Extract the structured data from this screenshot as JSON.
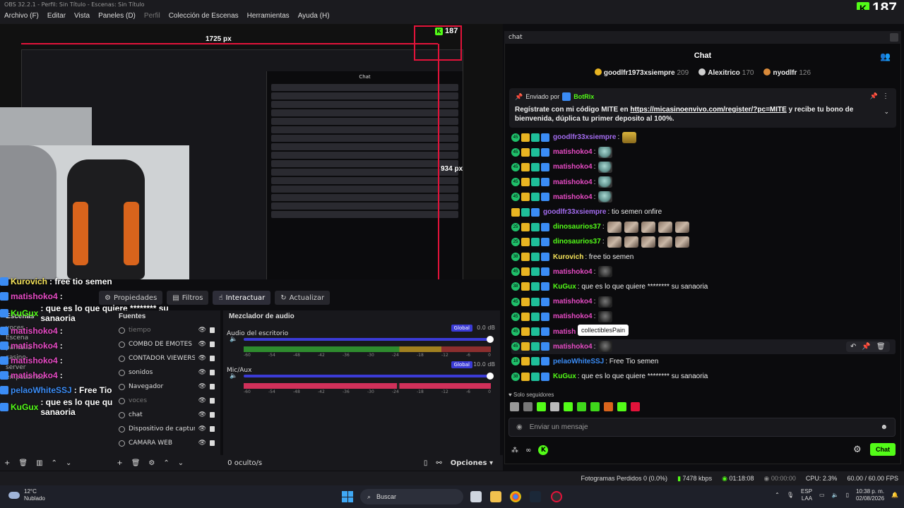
{
  "window": {
    "title": "OBS 32.2.1 - Perfil: Sin Título - Escenas: Sin Título",
    "viewer_count": "187"
  },
  "menu": [
    {
      "label": "Archivo (F)",
      "dim": false
    },
    {
      "label": "Editar",
      "dim": false
    },
    {
      "label": "Vista",
      "dim": false
    },
    {
      "label": "Paneles (D)",
      "dim": false
    },
    {
      "label": "Perfil",
      "dim": true
    },
    {
      "label": "Colección de Escenas",
      "dim": false
    },
    {
      "label": "Herramientas",
      "dim": false
    },
    {
      "label": "Ayuda (H)",
      "dim": false
    }
  ],
  "preview": {
    "width_label": "1725 px",
    "height_label": "934 px",
    "nested_count": "187",
    "nested_chat_title": "Chat"
  },
  "overlay_chat": [
    {
      "user": "Kurovich",
      "text": ": free tio semen",
      "color": "#f7e45a"
    },
    {
      "user": "matishoko4",
      "text": ":",
      "color": "#e64bc4"
    },
    {
      "user": "KuGux",
      "text": ": que es lo que quiere ******** su sanaoria",
      "color": "#53fc18"
    },
    {
      "user": "matishoko4",
      "text": ":",
      "color": "#e64bc4"
    },
    {
      "user": "matishoko4",
      "text": ":",
      "color": "#e64bc4"
    },
    {
      "user": "matishoko4",
      "text": ":",
      "color": "#e64bc4"
    },
    {
      "user": "matishoko4",
      "text": ":",
      "color": "#e64bc4"
    },
    {
      "user": "pelaoWhiteSSJ",
      "text": ": Free Tio semen",
      "color": "#3b8cf5"
    },
    {
      "user": "KuGux",
      "text": ": que es lo que quiere ******** su sanaoria",
      "color": "#53fc18"
    }
  ],
  "dock_tabs": [
    {
      "label": "Propiedades",
      "icon": "gear-icon",
      "active": false
    },
    {
      "label": "Filtros",
      "icon": "filter-icon",
      "active": false
    },
    {
      "label": "Interactuar",
      "icon": "pointer-icon",
      "active": true
    },
    {
      "label": "Actualizar",
      "icon": "refresh-icon",
      "active": false
    }
  ],
  "scenes": {
    "title": "Escenas",
    "items": [
      "voces",
      "Escena",
      "pantalla",
      "casino",
      "server",
      "empezamos"
    ]
  },
  "sources": {
    "title": "Fuentes",
    "items": [
      {
        "name": "tiempo",
        "dim": true
      },
      {
        "name": "COMBO DE EMOTES",
        "dim": false
      },
      {
        "name": "CONTADOR VIEWERS",
        "dim": false
      },
      {
        "name": "sonidos",
        "dim": false
      },
      {
        "name": "Navegador",
        "dim": false
      },
      {
        "name": "voces",
        "dim": true
      },
      {
        "name": "chat",
        "dim": false
      },
      {
        "name": "Dispositivo de captura",
        "dim": false
      },
      {
        "name": "CAMARA WEB",
        "dim": false
      }
    ]
  },
  "mixer": {
    "title": "Mezclador de audio",
    "tracks": [
      {
        "name": "Audio del escritorio",
        "mode": "Global",
        "db": "0.0 dB"
      },
      {
        "name": "Mic/Aux",
        "mode": "Global",
        "db": "10.0 dB"
      }
    ],
    "scale": [
      "-60",
      "-54",
      "-48",
      "-42",
      "-36",
      "-30",
      "-24",
      "-18",
      "-12",
      "-6",
      "0"
    ],
    "hidden": "0 oculto/s",
    "options": "Opciones"
  },
  "chat": {
    "tab_label": "chat",
    "title": "Chat",
    "gifters": [
      {
        "name": "goodlfr1973xsiempre",
        "count": "209",
        "color": "#e8b422"
      },
      {
        "name": "Alexitrico",
        "count": "170",
        "color": "#cfcfcf"
      },
      {
        "name": "nyodlfr",
        "count": "126",
        "color": "#d98a3a"
      }
    ],
    "pinned": {
      "sent_by": "Enviado por",
      "user": "BotRix",
      "text_before": "Regístrate con mi código MITE en ",
      "link": "https://micasinoenvivo.com/register/?pc=MITE",
      "text_after": " y recibe tu bono de bienvenida, dúplica tu primer deposito al 100%."
    },
    "messages": [
      {
        "user": "goodlfr33xsiempre",
        "color": "#a46cf0",
        "text": ":",
        "emote": "gold",
        "badge": "45"
      },
      {
        "user": "matishoko4",
        "color": "#e64bc4",
        "text": ":",
        "emote": "globe",
        "badge": "45"
      },
      {
        "user": "matishoko4",
        "color": "#e64bc4",
        "text": ":",
        "emote": "globe",
        "badge": "45"
      },
      {
        "user": "matishoko4",
        "color": "#e64bc4",
        "text": ":",
        "emote": "globe",
        "badge": "45"
      },
      {
        "user": "matishoko4",
        "color": "#e64bc4",
        "text": ":",
        "emote": "globe",
        "badge": "45"
      },
      {
        "user": "goodlfr33xsiempre",
        "color": "#a46cf0",
        "text": ": tio semen onfire",
        "emote": "",
        "badge": ""
      },
      {
        "user": "dinosaurios37",
        "color": "#53fc18",
        "text": ":",
        "emote": "photo",
        "badge": "25"
      },
      {
        "user": "dinosaurios37",
        "color": "#53fc18",
        "text": ":",
        "emote": "photo",
        "badge": "25"
      },
      {
        "user": "Kurovich",
        "color": "#f7e45a",
        "text": ": free tio semen",
        "emote": "",
        "badge": "38"
      },
      {
        "user": "matishoko4",
        "color": "#e64bc4",
        "text": ":",
        "emote": "dark",
        "badge": "45"
      },
      {
        "user": "KuGux",
        "color": "#53fc18",
        "text": ": que es lo que quiere ******** su sanaoria",
        "emote": "",
        "badge": "38"
      },
      {
        "user": "matishoko4",
        "color": "#e64bc4",
        "text": ":",
        "emote": "dark",
        "badge": "45"
      },
      {
        "user": "matishoko4",
        "color": "#e64bc4",
        "text": ":",
        "emote": "dark",
        "badge": "45"
      },
      {
        "user": "matish",
        "color": "#e64bc4",
        "text": "",
        "emote": "",
        "badge": "45"
      },
      {
        "user": "matishoko4",
        "color": "#e64bc4",
        "text": ":",
        "emote": "dark",
        "badge": "45"
      },
      {
        "user": "pelaoWhiteSSJ",
        "color": "#3b8cf5",
        "text": ": Free Tio semen",
        "emote": "",
        "badge": "18"
      },
      {
        "user": "KuGux",
        "color": "#53fc18",
        "text": ": que es lo que quiere ******** su sanaoria",
        "emote": "",
        "badge": "38"
      }
    ],
    "tooltip": "collectiblesPain",
    "followers_only": "Solo seguidores",
    "input_placeholder": "Enviar un mensaje",
    "send_label": "Chat"
  },
  "status": {
    "dropped": "Fotogramas Perdidos 0 (0.0%)",
    "bitrate": "7478 kbps",
    "live_time": "01:18:08",
    "rec_time": "00:00:00",
    "cpu": "CPU: 2.3%",
    "fps": "60.00 / 60.00 FPS"
  },
  "taskbar": {
    "temp": "12°C",
    "weather": "Nublado",
    "search": "Buscar",
    "lang1": "ESP",
    "lang2": "LAA",
    "time": "10:38 p. m.",
    "date": "02/08/2026"
  }
}
